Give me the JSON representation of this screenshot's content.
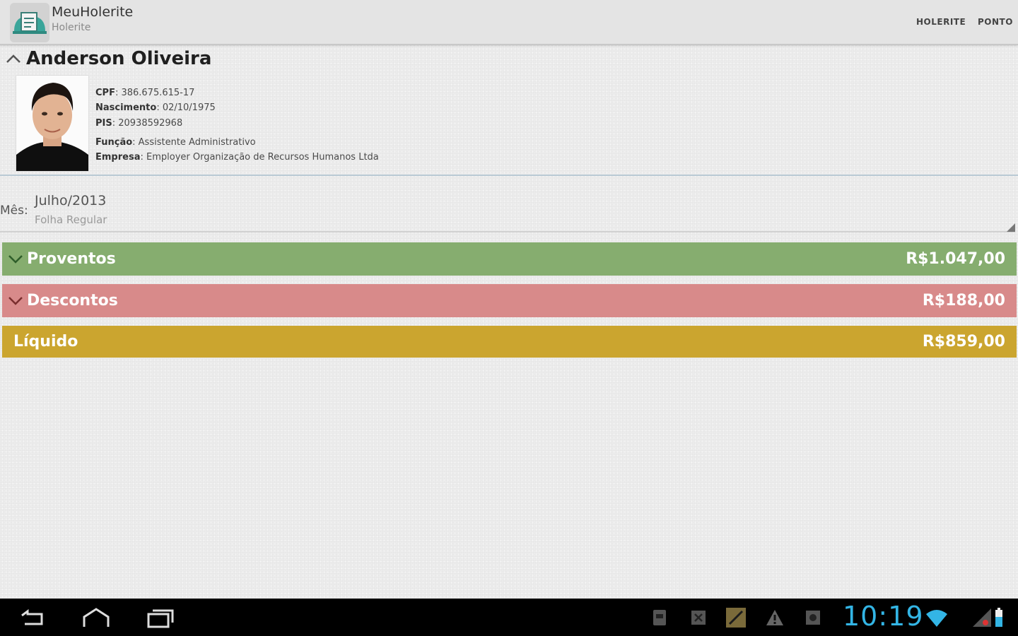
{
  "actionbar": {
    "title": "MeuHolerite",
    "subtitle": "Holerite",
    "menu": [
      {
        "label": "HOLERITE"
      },
      {
        "label": "PONTO"
      }
    ]
  },
  "employee": {
    "name": "Anderson Oliveira",
    "cpf_label": "CPF",
    "cpf": ": 386.675.615-17",
    "nascimento_label": "Nascimento",
    "nascimento": ": 02/10/1975",
    "pis_label": "PIS",
    "pis": ": 20938592968",
    "funcao_label": "Função",
    "funcao": ": Assistente Administrativo",
    "empresa_label": "Empresa",
    "empresa": ": Employer Organização de Recursos Humanos Ltda"
  },
  "month": {
    "label": "Mês:",
    "value": "Julho/2013",
    "sub": "Folha Regular"
  },
  "summary": {
    "proventos": {
      "label": "Proventos",
      "value": "R$1.047,00"
    },
    "descontos": {
      "label": "Descontos",
      "value": "R$188,00"
    },
    "liquido": {
      "label": "Líquido",
      "value": "R$859,00"
    }
  },
  "system": {
    "clock": "10:19"
  },
  "colors": {
    "proventos": "#86ad6f",
    "descontos": "#d88a8a",
    "liquido": "#cba52f",
    "clock": "#33b5e5"
  }
}
